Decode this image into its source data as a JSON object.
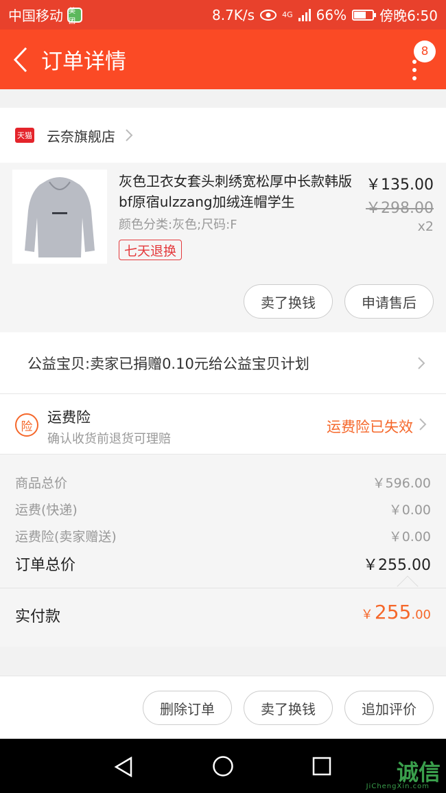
{
  "status_bar": {
    "carrier": "中国移动",
    "app_badge": "美团",
    "speed": "8.7K/s",
    "network": "4G",
    "battery": "66%",
    "battery_level": 0.66,
    "time": "傍晚6:50"
  },
  "header": {
    "title": "订单详情",
    "badge_count": "8"
  },
  "store": {
    "badge": "天猫",
    "name": "云奈旗舰店"
  },
  "product": {
    "title": "灰色卫衣女套头刺绣宽松厚中长款韩版bf原宿ulzzang加绒连帽学生",
    "spec": "颜色分类:灰色;尺码:F",
    "return_tag": "七天退换",
    "price": "￥135.00",
    "original_price": "￥298.00",
    "quantity": "x2",
    "buttons": {
      "sell": "卖了换钱",
      "after_sale": "申请售后"
    }
  },
  "charity": {
    "text": "公益宝贝:卖家已捐赠0.10元给公益宝贝计划"
  },
  "insurance": {
    "icon_char": "险",
    "title": "运费险",
    "subtitle": "确认收货前退货可理赔",
    "status": "运费险已失效"
  },
  "summary": {
    "rows": [
      {
        "label": "商品总价",
        "value": "￥596.00"
      },
      {
        "label": "运费(快递)",
        "value": "￥0.00"
      },
      {
        "label": "运费险(卖家赠送)",
        "value": "￥0.00"
      }
    ],
    "total_label": "订单总价",
    "total_value": "￥255.00",
    "paid_label": "实付款",
    "paid_currency": "￥",
    "paid_integer": "255",
    "paid_decimal": ".00"
  },
  "actions": {
    "delete": "删除订单",
    "sell": "卖了换钱",
    "review": "追加评价"
  },
  "watermark": {
    "text": "诚信",
    "sub": "JiChengXin.com"
  },
  "colors": {
    "accent": "#fb4a25",
    "orange": "#f5672a",
    "tmall": "#e4242b"
  }
}
